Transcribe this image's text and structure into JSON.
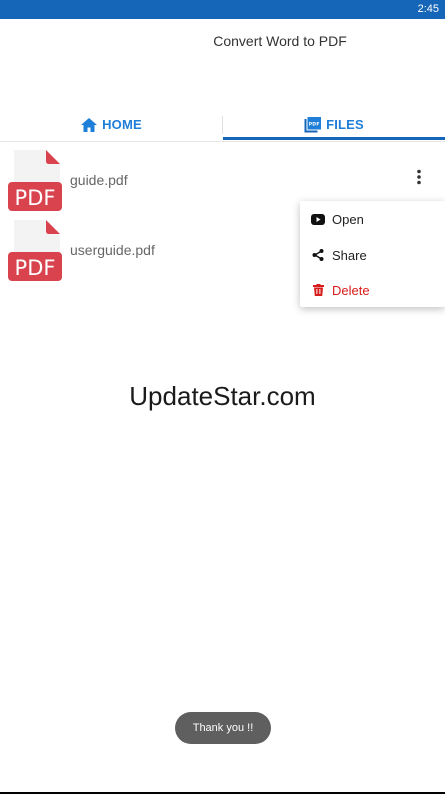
{
  "status_bar": {
    "time": "2:45"
  },
  "app": {
    "title": "Convert Word to PDF"
  },
  "tabs": [
    {
      "label": "HOME",
      "icon": "home-icon",
      "selected": false
    },
    {
      "label": "FILES",
      "icon": "pdf-file-icon",
      "selected": true
    }
  ],
  "files": [
    {
      "name": "guide.pdf",
      "icon_text": "PDF"
    },
    {
      "name": "userguide.pdf",
      "icon_text": "PDF"
    }
  ],
  "context_menu": {
    "items": [
      {
        "label": "Open",
        "icon": "youtube-play-icon"
      },
      {
        "label": "Share",
        "icon": "share-icon"
      },
      {
        "label": "Delete",
        "icon": "trash-icon",
        "color": "#d81b1b"
      }
    ]
  },
  "watermark": "UpdateStar.com",
  "toast": "Thank you !!",
  "colors": {
    "primary": "#1565b8",
    "tab_text": "#1e7ed8",
    "pdf_red": "#d9434e",
    "delete": "#d81b1b"
  }
}
